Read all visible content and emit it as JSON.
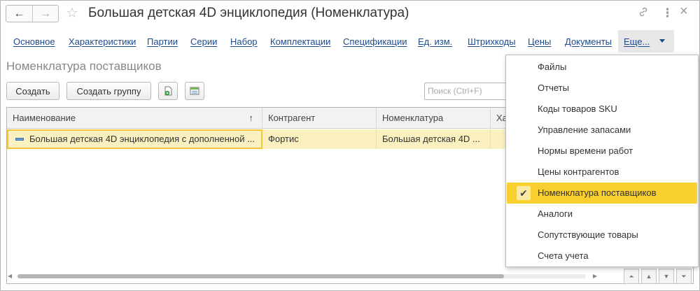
{
  "window": {
    "title": "Большая детская 4D энциклопедия (Номенклатура)",
    "nav_back": "←",
    "nav_forward": "→",
    "favorite_glyph": "☆",
    "link_glyph": "🔗",
    "more_glyph": "⋮",
    "close_glyph": "×"
  },
  "tabs": [
    "Основное",
    "Характеристики",
    "Партии",
    "Серии",
    "Набор",
    "Комплектации",
    "Спецификации",
    "Ед. изм.",
    "Штрихкоды",
    "Цены",
    "Документы"
  ],
  "more_tab": {
    "label": "Еще..."
  },
  "section": {
    "title": "Номенклатура поставщиков"
  },
  "toolbar": {
    "create_label": "Создать",
    "create_group_label": "Создать группу",
    "search_placeholder": "Поиск (Ctrl+F)"
  },
  "table": {
    "columns": [
      "Наименование",
      "Контрагент",
      "Номенклатура",
      "Ха"
    ],
    "sort_glyph": "↑",
    "rows": [
      {
        "name": "Большая детская 4D энциклопедия с дополненной ...",
        "counterparty": "Фортис",
        "nomenclature": "Большая детская 4D ..."
      }
    ]
  },
  "menu": {
    "check_glyph": "✔",
    "items": [
      "Файлы",
      "Отчеты",
      "Коды товаров SKU",
      "Управление запасами",
      "Нормы времени работ",
      "Цены контрагентов",
      "Номенклатура поставщиков",
      "Аналоги",
      "Сопутствующие товары",
      "Счета учета"
    ],
    "active_index": 6
  },
  "pager": [
    "⏶",
    "▲",
    "▼",
    "⏷"
  ],
  "colors": {
    "link": "#1c4b8c",
    "selected_row": "#fbf0c0",
    "menu_active": "#f8cf2e"
  }
}
